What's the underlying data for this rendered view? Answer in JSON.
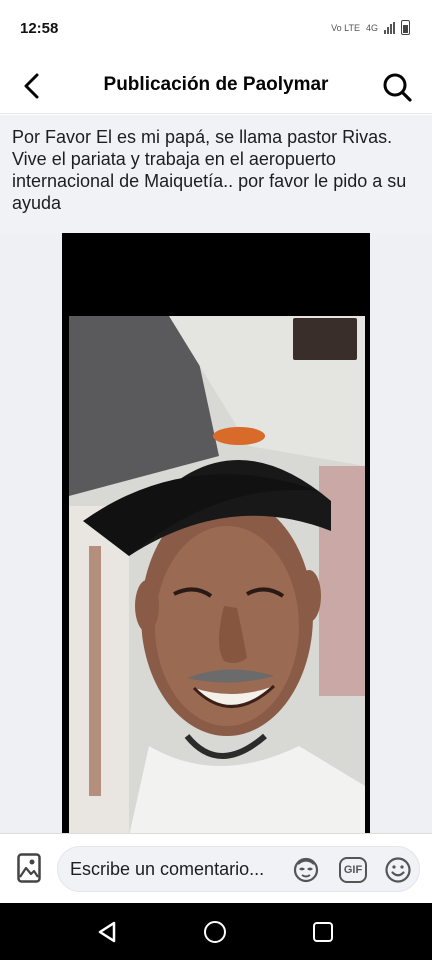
{
  "status_bar": {
    "time": "12:58",
    "network_label": "Vo LTE",
    "signal_label": "4G"
  },
  "header": {
    "title": "Publicación de Paolymar",
    "back_icon": "chevron-left-icon",
    "search_icon": "search-icon"
  },
  "post": {
    "text": "Por Favor El es mi papá, se llama pastor Rivas. Vive el pariata y trabaja en el aeropuerto internacional de Maiquetía.. por favor le pido a su ayuda",
    "image_content": "video-call-screenshot"
  },
  "comment_bar": {
    "placeholder": "Escribe un comentario...",
    "gif_label": "GIF",
    "photo_icon": "image-icon",
    "avatar_sticker_icon": "avatar-sticker-icon",
    "emoji_icon": "smiley-icon"
  },
  "nav_bar": {
    "back_icon": "triangle-back-icon",
    "home_icon": "circle-home-icon",
    "recent_icon": "square-recents-icon"
  },
  "colors": {
    "header_bg": "#ffffff",
    "post_text_bg": "#f0f2f5",
    "nav_bg": "#000000"
  }
}
